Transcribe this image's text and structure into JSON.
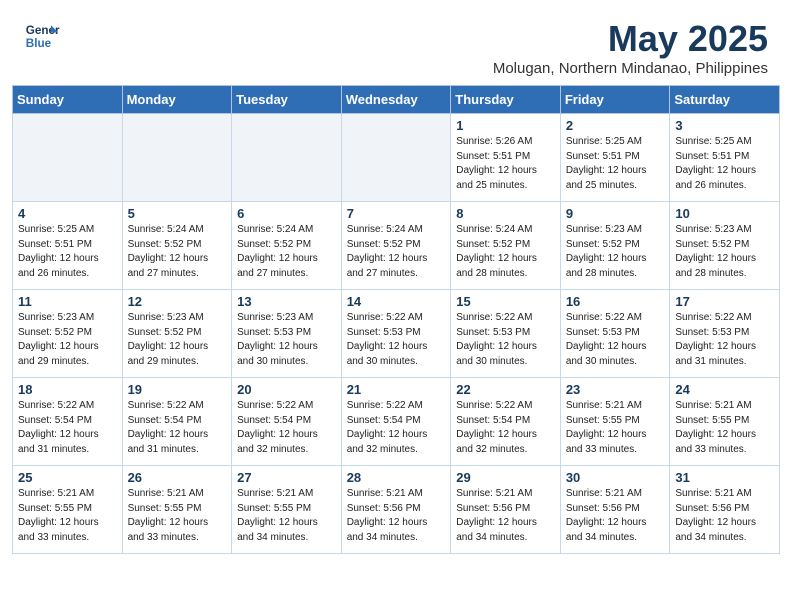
{
  "logo": {
    "line1": "General",
    "line2": "Blue"
  },
  "title": "May 2025",
  "location": "Molugan, Northern Mindanao, Philippines",
  "days_of_week": [
    "Sunday",
    "Monday",
    "Tuesday",
    "Wednesday",
    "Thursday",
    "Friday",
    "Saturday"
  ],
  "weeks": [
    [
      {
        "num": "",
        "info": ""
      },
      {
        "num": "",
        "info": ""
      },
      {
        "num": "",
        "info": ""
      },
      {
        "num": "",
        "info": ""
      },
      {
        "num": "1",
        "info": "Sunrise: 5:26 AM\nSunset: 5:51 PM\nDaylight: 12 hours\nand 25 minutes."
      },
      {
        "num": "2",
        "info": "Sunrise: 5:25 AM\nSunset: 5:51 PM\nDaylight: 12 hours\nand 25 minutes."
      },
      {
        "num": "3",
        "info": "Sunrise: 5:25 AM\nSunset: 5:51 PM\nDaylight: 12 hours\nand 26 minutes."
      }
    ],
    [
      {
        "num": "4",
        "info": "Sunrise: 5:25 AM\nSunset: 5:51 PM\nDaylight: 12 hours\nand 26 minutes."
      },
      {
        "num": "5",
        "info": "Sunrise: 5:24 AM\nSunset: 5:52 PM\nDaylight: 12 hours\nand 27 minutes."
      },
      {
        "num": "6",
        "info": "Sunrise: 5:24 AM\nSunset: 5:52 PM\nDaylight: 12 hours\nand 27 minutes."
      },
      {
        "num": "7",
        "info": "Sunrise: 5:24 AM\nSunset: 5:52 PM\nDaylight: 12 hours\nand 27 minutes."
      },
      {
        "num": "8",
        "info": "Sunrise: 5:24 AM\nSunset: 5:52 PM\nDaylight: 12 hours\nand 28 minutes."
      },
      {
        "num": "9",
        "info": "Sunrise: 5:23 AM\nSunset: 5:52 PM\nDaylight: 12 hours\nand 28 minutes."
      },
      {
        "num": "10",
        "info": "Sunrise: 5:23 AM\nSunset: 5:52 PM\nDaylight: 12 hours\nand 28 minutes."
      }
    ],
    [
      {
        "num": "11",
        "info": "Sunrise: 5:23 AM\nSunset: 5:52 PM\nDaylight: 12 hours\nand 29 minutes."
      },
      {
        "num": "12",
        "info": "Sunrise: 5:23 AM\nSunset: 5:52 PM\nDaylight: 12 hours\nand 29 minutes."
      },
      {
        "num": "13",
        "info": "Sunrise: 5:23 AM\nSunset: 5:53 PM\nDaylight: 12 hours\nand 30 minutes."
      },
      {
        "num": "14",
        "info": "Sunrise: 5:22 AM\nSunset: 5:53 PM\nDaylight: 12 hours\nand 30 minutes."
      },
      {
        "num": "15",
        "info": "Sunrise: 5:22 AM\nSunset: 5:53 PM\nDaylight: 12 hours\nand 30 minutes."
      },
      {
        "num": "16",
        "info": "Sunrise: 5:22 AM\nSunset: 5:53 PM\nDaylight: 12 hours\nand 30 minutes."
      },
      {
        "num": "17",
        "info": "Sunrise: 5:22 AM\nSunset: 5:53 PM\nDaylight: 12 hours\nand 31 minutes."
      }
    ],
    [
      {
        "num": "18",
        "info": "Sunrise: 5:22 AM\nSunset: 5:54 PM\nDaylight: 12 hours\nand 31 minutes."
      },
      {
        "num": "19",
        "info": "Sunrise: 5:22 AM\nSunset: 5:54 PM\nDaylight: 12 hours\nand 31 minutes."
      },
      {
        "num": "20",
        "info": "Sunrise: 5:22 AM\nSunset: 5:54 PM\nDaylight: 12 hours\nand 32 minutes."
      },
      {
        "num": "21",
        "info": "Sunrise: 5:22 AM\nSunset: 5:54 PM\nDaylight: 12 hours\nand 32 minutes."
      },
      {
        "num": "22",
        "info": "Sunrise: 5:22 AM\nSunset: 5:54 PM\nDaylight: 12 hours\nand 32 minutes."
      },
      {
        "num": "23",
        "info": "Sunrise: 5:21 AM\nSunset: 5:55 PM\nDaylight: 12 hours\nand 33 minutes."
      },
      {
        "num": "24",
        "info": "Sunrise: 5:21 AM\nSunset: 5:55 PM\nDaylight: 12 hours\nand 33 minutes."
      }
    ],
    [
      {
        "num": "25",
        "info": "Sunrise: 5:21 AM\nSunset: 5:55 PM\nDaylight: 12 hours\nand 33 minutes."
      },
      {
        "num": "26",
        "info": "Sunrise: 5:21 AM\nSunset: 5:55 PM\nDaylight: 12 hours\nand 33 minutes."
      },
      {
        "num": "27",
        "info": "Sunrise: 5:21 AM\nSunset: 5:55 PM\nDaylight: 12 hours\nand 34 minutes."
      },
      {
        "num": "28",
        "info": "Sunrise: 5:21 AM\nSunset: 5:56 PM\nDaylight: 12 hours\nand 34 minutes."
      },
      {
        "num": "29",
        "info": "Sunrise: 5:21 AM\nSunset: 5:56 PM\nDaylight: 12 hours\nand 34 minutes."
      },
      {
        "num": "30",
        "info": "Sunrise: 5:21 AM\nSunset: 5:56 PM\nDaylight: 12 hours\nand 34 minutes."
      },
      {
        "num": "31",
        "info": "Sunrise: 5:21 AM\nSunset: 5:56 PM\nDaylight: 12 hours\nand 34 minutes."
      }
    ]
  ]
}
